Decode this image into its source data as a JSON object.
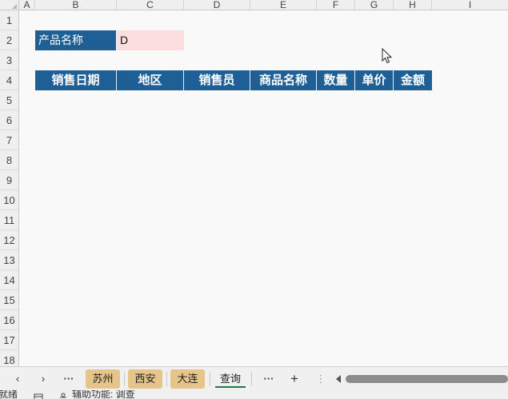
{
  "columns": [
    "A",
    "B",
    "C",
    "D",
    "E",
    "F",
    "G",
    "H",
    "I"
  ],
  "rows": [
    "1",
    "2",
    "3",
    "4",
    "5",
    "6",
    "7",
    "8",
    "9",
    "10",
    "11",
    "12",
    "13",
    "14",
    "15",
    "16",
    "17",
    "18"
  ],
  "criteria": {
    "label": "产品名称",
    "value": "D"
  },
  "table_headers": [
    "销售日期",
    "地区",
    "销售员",
    "商品名称",
    "数量",
    "单价",
    "金额"
  ],
  "colors": {
    "header_fill": "#1e5f96",
    "input_fill": "#fddede",
    "tab_fill": "#e6c58a",
    "active_underline": "#1f7a45"
  },
  "tabbar": {
    "prev_icon": "‹",
    "next_icon": "›",
    "more_left": "···",
    "tabs": [
      {
        "label": "苏州",
        "active": false
      },
      {
        "label": "西安",
        "active": false
      },
      {
        "label": "大连",
        "active": false
      },
      {
        "label": "查询",
        "active": true
      }
    ],
    "more_right": "···",
    "add_icon": "+",
    "options_icon": "⋮"
  },
  "statusbar": {
    "ready": "就绪",
    "accessibility": "辅助功能: 调查"
  }
}
